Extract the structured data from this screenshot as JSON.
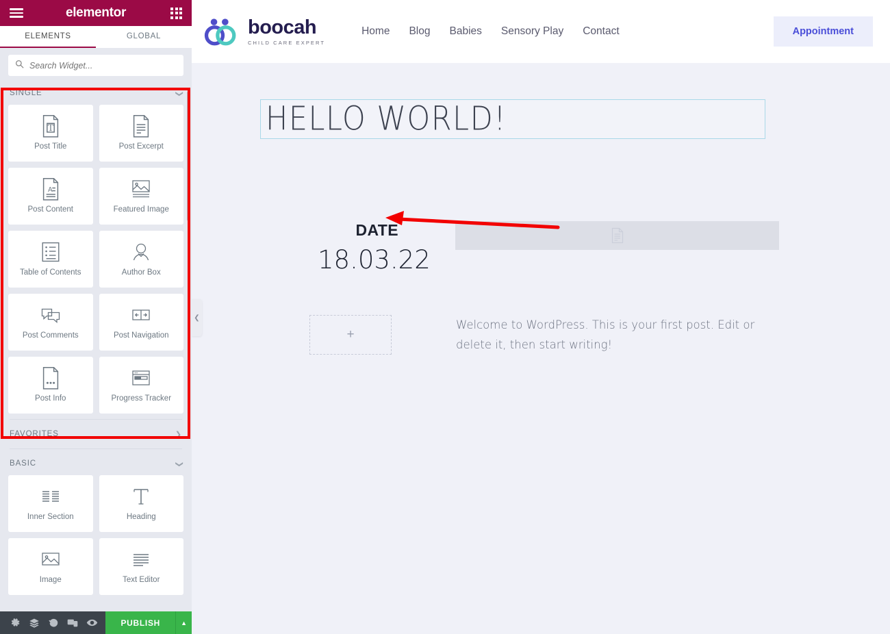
{
  "panel": {
    "brand": "elementor",
    "menu_icon": "hamburger-icon",
    "apps_icon": "grid-apps-icon",
    "tabs": [
      {
        "label": "ELEMENTS",
        "active": true
      },
      {
        "label": "GLOBAL",
        "active": false
      }
    ],
    "search": {
      "placeholder": "Search Widget...",
      "value": "",
      "icon": "search-icon"
    },
    "categories": [
      {
        "name": "SINGLE",
        "expanded": true,
        "chevron": "chevron-down-icon",
        "highlighted": true,
        "widgets": [
          {
            "label": "Post Title",
            "icon": "post-title-icon"
          },
          {
            "label": "Post Excerpt",
            "icon": "post-excerpt-icon"
          },
          {
            "label": "Post Content",
            "icon": "post-content-icon"
          },
          {
            "label": "Featured Image",
            "icon": "featured-image-icon"
          },
          {
            "label": "Table of Contents",
            "icon": "table-of-contents-icon"
          },
          {
            "label": "Author Box",
            "icon": "author-box-icon"
          },
          {
            "label": "Post Comments",
            "icon": "post-comments-icon"
          },
          {
            "label": "Post Navigation",
            "icon": "post-navigation-icon"
          },
          {
            "label": "Post Info",
            "icon": "post-info-icon"
          },
          {
            "label": "Progress Tracker",
            "icon": "progress-tracker-icon"
          }
        ]
      },
      {
        "name": "FAVORITES",
        "expanded": false,
        "chevron": "chevron-right-icon",
        "highlighted": false,
        "widgets": []
      },
      {
        "name": "BASIC",
        "expanded": true,
        "chevron": "chevron-down-icon",
        "highlighted": false,
        "widgets": [
          {
            "label": "Inner Section",
            "icon": "inner-section-icon"
          },
          {
            "label": "Heading",
            "icon": "heading-icon"
          },
          {
            "label": "Image",
            "icon": "image-icon"
          },
          {
            "label": "Text Editor",
            "icon": "text-editor-icon"
          }
        ]
      }
    ],
    "footer": {
      "buttons": [
        {
          "name": "settings",
          "icon": "gear-icon"
        },
        {
          "name": "navigator",
          "icon": "layers-icon"
        },
        {
          "name": "history",
          "icon": "history-icon"
        },
        {
          "name": "responsive-mode",
          "icon": "responsive-icon"
        },
        {
          "name": "preview",
          "icon": "eye-icon"
        }
      ],
      "publish_label": "PUBLISH",
      "publish_arrow_icon": "caret-up-icon"
    },
    "highlight_color": "#f20000",
    "brand_color": "#9b0a46",
    "publish_color": "#39b54a"
  },
  "canvas": {
    "collapse_handle_icon": "chevron-left-icon",
    "site": {
      "logo": {
        "name": "boocah",
        "tagline": "CHILD CARE EXPERT",
        "icon": "boocah-logo-icon",
        "color_primary": "#4f4ec9",
        "color_secondary": "#4ec9c0"
      },
      "nav": [
        {
          "label": "Home"
        },
        {
          "label": "Blog"
        },
        {
          "label": "Babies"
        },
        {
          "label": "Sensory Play"
        },
        {
          "label": "Contact"
        }
      ],
      "cta": {
        "label": "Appointment",
        "color": "#4a4ed8",
        "background": "#eceefb"
      }
    },
    "post": {
      "title": "HELLO WORLD!",
      "date_label": "DATE",
      "date_value": "18.03.22",
      "featured_image_placeholder_icon": "document-icon",
      "add_widget_icon": "plus-icon",
      "body": "Welcome to WordPress. This is your first post. Edit or delete it, then start writing!"
    }
  },
  "annotation": {
    "arrow": {
      "direction": "left",
      "color": "#f20000"
    }
  }
}
